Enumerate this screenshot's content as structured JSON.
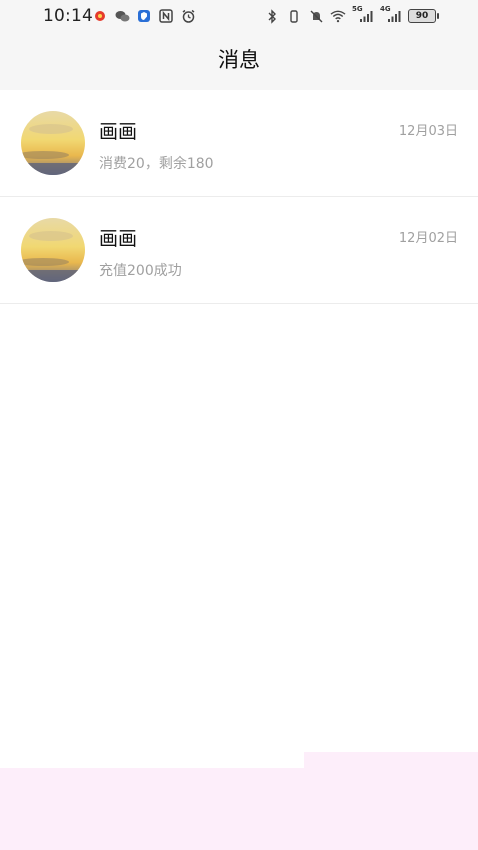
{
  "status_bar": {
    "time": "10:14",
    "battery": "90",
    "net_5g": "5G",
    "net_4g": "4G"
  },
  "header": {
    "title": "消息"
  },
  "messages": [
    {
      "name": "画画",
      "desc": "消费20，剩余180",
      "date": "12月03日"
    },
    {
      "name": "画画",
      "desc": "充值200成功",
      "date": "12月02日"
    }
  ],
  "colors": {
    "header_bg": "#f6f6f6",
    "muted_text": "#a0a0a0",
    "bottom_band": "#fdeefa"
  }
}
